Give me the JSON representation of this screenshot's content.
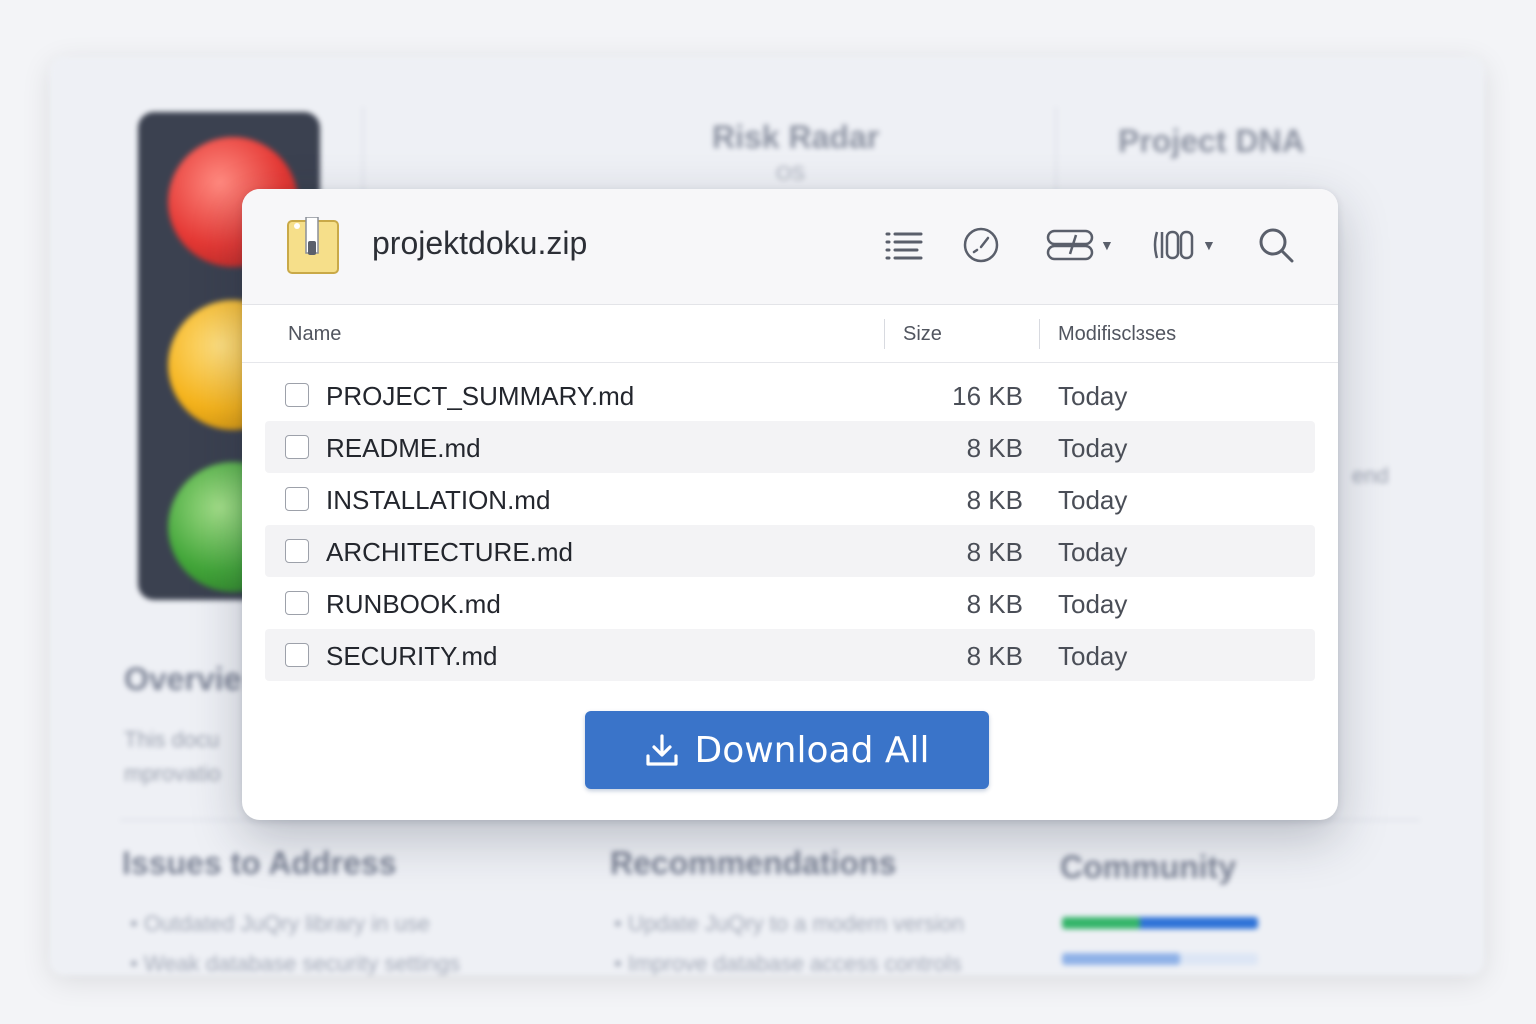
{
  "background": {
    "risk_radar_title": "Risk Radar",
    "risk_radar_sub": "OS",
    "project_dna_title": "Project DNA",
    "overview_heading": "Overvie",
    "overview_line1": "This docu",
    "overview_line2": "mprovatio",
    "side_text": "end",
    "issues_heading": "Issues to Address",
    "issues": [
      "Outdated JuQry library in use",
      "Weak database security settings"
    ],
    "recommendations_heading": "Recommendations",
    "recommendations": [
      "Update JuQry to a modern version",
      "Improve database access controls"
    ],
    "community_heading": "Community"
  },
  "dialog": {
    "title": "projektdoku.zip",
    "icons": {
      "archive": "zip-archive-icon",
      "list_view": "list-view-icon",
      "gauge": "gauge-icon",
      "toggle_group": "toggle-group-icon",
      "columns": "columns-icon",
      "search": "search-icon"
    },
    "columns": {
      "name": "Name",
      "size": "Size",
      "modified": "Modifisclɜses"
    },
    "files": [
      {
        "name": "PROJECT_SUMMARY.md",
        "size": "16 KB",
        "modified": "Today"
      },
      {
        "name": "README.md",
        "size": "8 KB",
        "modified": "Today"
      },
      {
        "name": "INSTALLATION.md",
        "size": "8 KB",
        "modified": "Today"
      },
      {
        "name": "ARCHITECTURE.md",
        "size": "8 KB",
        "modified": "Today"
      },
      {
        "name": "RUNBOOK.md",
        "size": "8 KB",
        "modified": "Today"
      },
      {
        "name": "SECURITY.md",
        "size": "8 KB",
        "modified": "Today"
      }
    ],
    "download_label": "Download All",
    "accent_color": "#3a74c9"
  }
}
